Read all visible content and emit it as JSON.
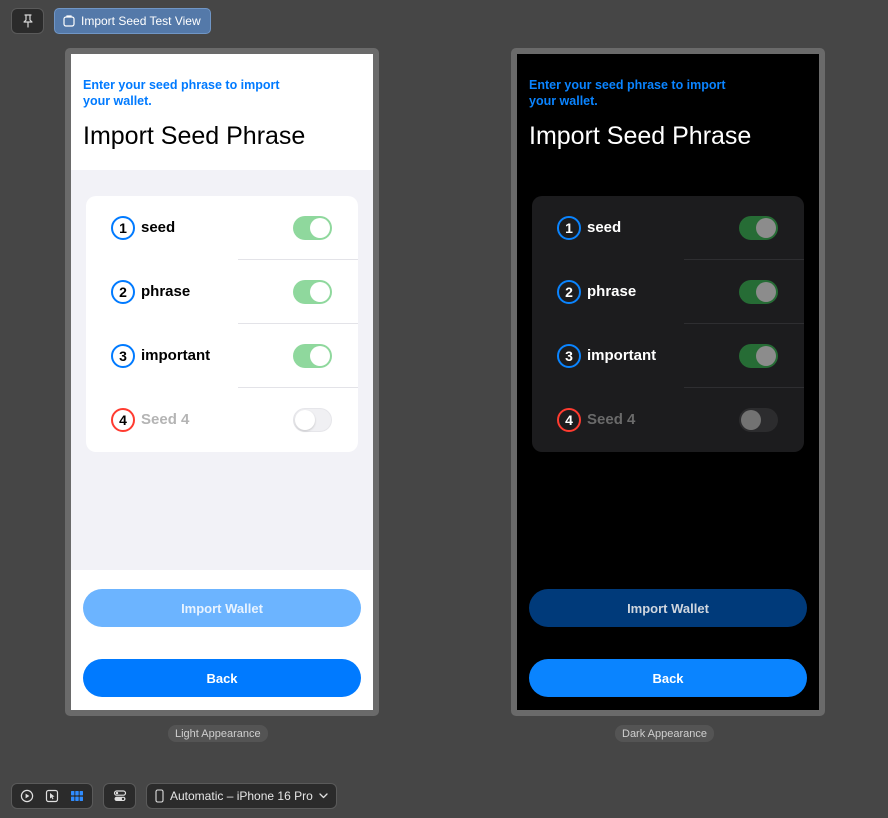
{
  "toolbar": {
    "pin_icon": "pin-icon",
    "tab_label": "Import Seed Test View",
    "tab_icon": "window-icon"
  },
  "preview": {
    "subtitle": "Enter your seed phrase to import your wallet.",
    "title": "Import Seed Phrase",
    "rows": [
      {
        "number": "1",
        "label": "seed",
        "toggle_on": true
      },
      {
        "number": "2",
        "label": "phrase",
        "toggle_on": true
      },
      {
        "number": "3",
        "label": "important",
        "toggle_on": true
      },
      {
        "number": "4",
        "label": "Seed 4",
        "toggle_on": false
      }
    ],
    "import_button": "Import Wallet",
    "back_button": "Back"
  },
  "captions": {
    "light": "Light Appearance",
    "dark": "Dark Appearance"
  },
  "bottom_bar": {
    "device_label": "Automatic – iPhone 16 Pro",
    "icons": [
      "play-icon",
      "select-icon",
      "grid-icon",
      "variants-icon",
      "phone-icon",
      "chevron-down-icon"
    ]
  },
  "colors": {
    "accent": "#007aff",
    "toggle_on_light": "#8fd89d",
    "toggle_on_dark": "#266c35",
    "alert_red": "#ff3b30"
  }
}
